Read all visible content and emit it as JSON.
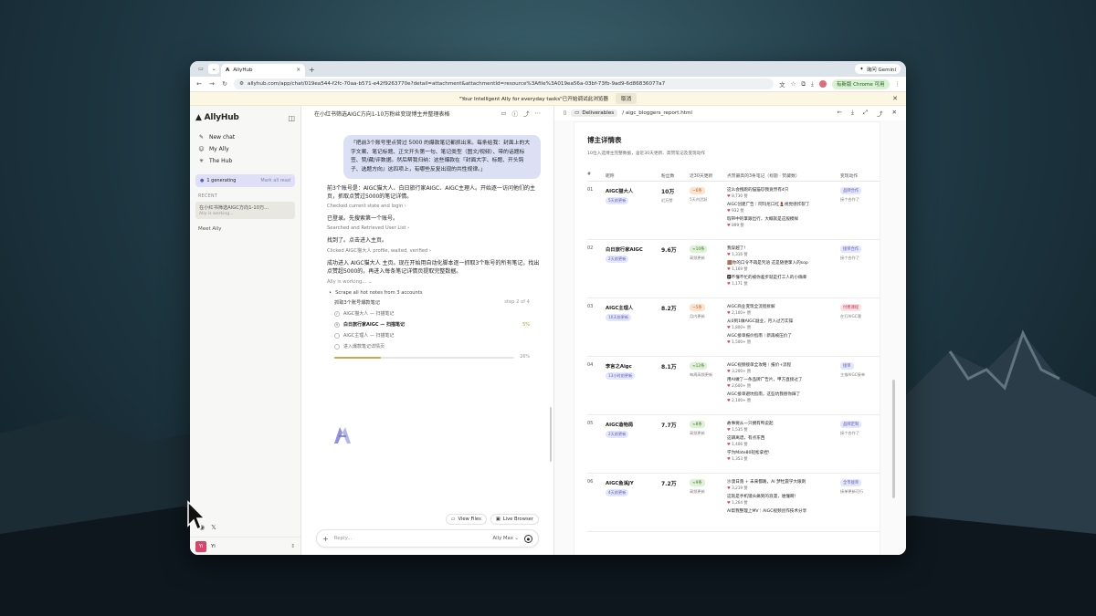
{
  "browser": {
    "tab_title": "AllyHub",
    "gemini_label": "询问 Gemini",
    "url": "allyhub.com/app/chat/019ea544-f2fc-70aa-b571-e42f9263770e?detail=attachment&attachmentId=resource%3Afile%3A019ea56a-03bf-73fb-9ad9-6d86836077a7",
    "new_version": "有新版 Chrome 可用",
    "notif_text": "\"Your Intelligent Ally for everyday tasks\"已开始调试此浏览器",
    "notif_cancel": "取消"
  },
  "sidebar": {
    "logo": "AllyHub",
    "nav": [
      {
        "label": "New chat",
        "icon": "edit-icon"
      },
      {
        "label": "My Ally",
        "icon": "smile-icon"
      },
      {
        "label": "The Hub",
        "icon": "hub-icon"
      }
    ],
    "generating": "1 generating",
    "mark_all_read": "Mark all read",
    "recent_header": "RECENT",
    "recent_item_title": "在小红书筛选AIGC方向1-10万...",
    "recent_item_status": "Ally is working...",
    "meet": "Meet Ally",
    "user_initials": "Yi",
    "user_name": "Yi"
  },
  "chat": {
    "title": "在小红书筛选AIGC方向1-10万粉丝变现博主并整理表格",
    "user_message": "「把前3个账号里点赞过 5000 的爆款笔记都抓出来。每条给我：封面上的大字文案、笔记标题、正文开头第一句、笔记类型（图文/视频）、带的话题标签、赞/藏/评数据。然后帮我归纳：这些爆款在『封面大字、标题、开头钩子、选题方向』这四项上，有哪些反复出现的共性规律。」",
    "p1": "前3个账号是：AIGC猫大人、白日旅行家AIGC、AIGC主理人。开始逐一访问他们的主页，抓取点赞过5000的笔记详情。",
    "s1": "Checked current state and login",
    "p2": "已登录。先搜索第一个账号。",
    "s2": "Searched and Retrieved User List",
    "p3": "找到了。点击进入主页。",
    "s3": "Clicked AIGC猫大人 profile, waited, verified",
    "p4": "成功进入 AIGC猫大人 主页。现在开始用自动化脚本逐一抓取3个账号的所有笔记，找出点赞超5000的，再进入每条笔记详情页提取完整数据。",
    "working": "Ally is working...",
    "todo_header": "Scrape all hot notes from 3 accounts",
    "task_title": "抓取3个账号爆款笔记",
    "task_step": "step 2 of 4",
    "tasks": [
      {
        "label": "AIGC猫大人 — 扫描笔记",
        "mark": "✓",
        "pct": ""
      },
      {
        "label": "白日旅行家AIGC — 扫描笔记",
        "mark": "✕",
        "pct": "5%"
      },
      {
        "label": "AIGC主理人 — 扫描笔记",
        "mark": "",
        "pct": ""
      },
      {
        "label": "进入爆款笔记详情页",
        "mark": "",
        "pct": ""
      }
    ],
    "progress": 26,
    "progress_label": "26%",
    "view_files": "View Files",
    "live_browser": "Live Browser",
    "reply_placeholder": "Reply...",
    "model": "Ally Max"
  },
  "report": {
    "deliverables": "Deliverables",
    "file": "/ aigc_bloggers_report.html",
    "title": "博主详情表",
    "subtitle": "10位入选博主完整数据，含近30天更新、高赞笔记及变现动作",
    "headers": [
      "#",
      "昵称",
      "粉丝数",
      "近30天更新",
      "点赞最高的3条笔记（标题 · 赞藏数）",
      "变现动作"
    ],
    "rows": [
      {
        "no": "01",
        "name": "AIGC猫大人",
        "tag": "5天前更新",
        "fans": "10万",
        "fans_sub": "近万赞",
        "update": "~6条",
        "update_sub": "5天内活跃",
        "update_color": "#fbe3cf",
        "update_text": "#b9672a",
        "notes": [
          {
            "t": "这么会拽跑的猫猫🐱我竟然有4只",
            "l": "8,730 赞"
          },
          {
            "t": "AIGC创建广告｜阿玛尼口红💄视觉感炸裂了",
            "l": "932 赞"
          },
          {
            "t": "瑕带中的掌跟出行，大概就是这般模样",
            "l": "899 赞"
          }
        ],
        "act": "品牌合作",
        "act_sub": "接个合作了",
        "act_color": "#e4e6fb",
        "act_text": "#5a5fb5"
      },
      {
        "no": "02",
        "name": "白日旅行家AIGC",
        "tag": "2天前更新",
        "fans": "9.6万",
        "fans_sub": "",
        "update": "≈10条",
        "update_sub": "高频更新",
        "update_color": "#dff2d8",
        "update_text": "#3f7a2f",
        "notes": [
          {
            "t": "我穿越了!",
            "l": "1,316 赞"
          },
          {
            "t": "🟫你的口令不再是咒语 这是随便掌入的sop",
            "l": "1,169 赞"
          },
          {
            "t": "🅿不懂不忙的被你差步就是打工人的小确幸",
            "l": "1,171 赞"
          }
        ],
        "act": "接单合作",
        "act_sub": "接个合作了",
        "act_color": "#e4e6fb",
        "act_text": "#5a5fb5"
      },
      {
        "no": "03",
        "name": "AIGC主理人",
        "tag": "10天前更新",
        "fans": "8.2万",
        "fans_sub": "",
        "update": "~5条",
        "update_sub": "月内更新",
        "update_color": "#fbe3cf",
        "update_text": "#b9672a",
        "notes": [
          {
            "t": "AIGC商业变现全流程拆解",
            "l": "2,100+ 赞"
          },
          {
            "t": "从0到1做AIGC副业，月入过万实操",
            "l": "1,800+ 赞"
          },
          {
            "t": "AIGC接单报价指南｜新再被压价了",
            "l": "1,500+ 赞"
          }
        ],
        "act": "付费课程",
        "act_sub": "在打AIGC课",
        "act_color": "#fbe1e4",
        "act_text": "#c0394e"
      },
      {
        "no": "04",
        "name": "李言之Aigc",
        "tag": "13小时前更新",
        "fans": "8.1万",
        "fans_sub": "",
        "update": "≈12条",
        "update_sub": "每周高频更新",
        "update_color": "#dff2d8",
        "update_text": "#3f7a2f",
        "notes": [
          {
            "t": "AIGC视频接单全攻略｜报价+流程",
            "l": "3,200+ 赞"
          },
          {
            "t": "用AI做了一条品牌广告片，甲方直接过了",
            "l": "2,600+ 赞"
          },
          {
            "t": "AIGC接单避坑指南，这些坑我替你踩了",
            "l": "2,100+ 赞"
          }
        ],
        "act": "接单",
        "act_sub": "主推AIGC接单",
        "act_color": "#e4e6fb",
        "act_text": "#5a5fb5"
      },
      {
        "no": "05",
        "name": "AIGC造物局",
        "tag": "2天前更新",
        "fans": "7.7万",
        "fans_sub": "",
        "update": "≈8条",
        "update_sub": "高频更新",
        "update_color": "#dff2d8",
        "update_text": "#3f7a2f",
        "notes": [
          {
            "t": "故事要从一只拥有鸭说起",
            "l": "1,535 赞"
          },
          {
            "t": "这辆离谱，有点东西",
            "l": "1,406 赞"
          },
          {
            "t": "学为Mate80轻松拿捏!",
            "l": "1,353 赞"
          }
        ],
        "act": "品牌定制",
        "act_sub": "接个合作了",
        "act_color": "#e4e6fb",
        "act_text": "#5a5fb5"
      },
      {
        "no": "06",
        "name": "AIGC鱼溪JY",
        "tag": "4天前更新",
        "fans": "7.2万",
        "fans_sub": "",
        "update": "≈9条",
        "update_sub": "高频更新",
        "update_color": "#dff2d8",
        "update_text": "#3f7a2f",
        "notes": [
          {
            "t": "沙漠日落 + 未来都路，AI 梦牡震学大眼刺",
            "l": "3,219 赞"
          },
          {
            "t": "这就是手机镜头痛到的浪漫，谁懂啊!",
            "l": "1,264 赞"
          },
          {
            "t": "AI帮我整理上MV｜AIGC视频创作技术分享",
            "l": ""
          }
        ],
        "act": "全币接单",
        "act_sub": "接单更新可行",
        "act_color": "#e4e6fb",
        "act_text": "#5a5fb5"
      }
    ]
  }
}
